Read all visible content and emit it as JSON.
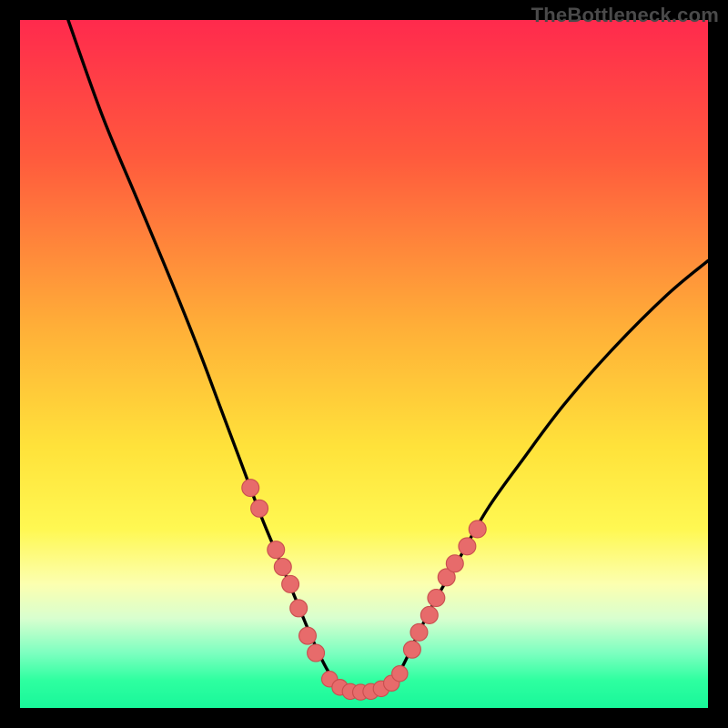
{
  "watermark": "TheBottleneck.com",
  "colors": {
    "frame": "#000000",
    "curve": "#000000",
    "marker_fill": "#e76b6b",
    "marker_stroke": "#c94f4f",
    "gradient_stops": [
      {
        "offset": 0.0,
        "color": "#ff2a4d"
      },
      {
        "offset": 0.2,
        "color": "#ff5a3d"
      },
      {
        "offset": 0.45,
        "color": "#ffb038"
      },
      {
        "offset": 0.62,
        "color": "#ffe23a"
      },
      {
        "offset": 0.74,
        "color": "#fff852"
      },
      {
        "offset": 0.82,
        "color": "#fcffb0"
      },
      {
        "offset": 0.87,
        "color": "#d8ffcf"
      },
      {
        "offset": 0.92,
        "color": "#7dffc0"
      },
      {
        "offset": 0.96,
        "color": "#2effa0"
      },
      {
        "offset": 1.0,
        "color": "#18f79a"
      }
    ]
  },
  "chart_data": {
    "type": "line",
    "title": "",
    "xlabel": "",
    "ylabel": "",
    "xlim": [
      0,
      100
    ],
    "ylim": [
      0,
      100
    ],
    "series": [
      {
        "name": "bottleneck-curve",
        "x": [
          7,
          12,
          17,
          22,
          26,
          29,
          32,
          35,
          37.5,
          40,
          42.5,
          45,
          47.5,
          50,
          52.5,
          55,
          57.5,
          60,
          64,
          68,
          73,
          79,
          86,
          94,
          100
        ],
        "y": [
          100,
          86,
          74,
          62,
          52,
          44,
          36,
          28,
          22,
          16,
          10,
          5,
          2.5,
          2,
          2.5,
          5,
          10,
          15,
          22,
          29,
          36,
          44,
          52,
          60,
          65
        ]
      }
    ],
    "markers_left": {
      "name": "left-cluster",
      "x": [
        33.5,
        34.8,
        37.2,
        38.2,
        39.3,
        40.5,
        41.8,
        43.0
      ],
      "y": [
        32.0,
        29.0,
        23.0,
        20.5,
        18.0,
        14.5,
        10.5,
        8.0
      ]
    },
    "markers_right": {
      "name": "right-cluster",
      "x": [
        57.0,
        58.0,
        59.5,
        60.5,
        62.0,
        63.2,
        65.0,
        66.5
      ],
      "y": [
        8.5,
        11.0,
        13.5,
        16.0,
        19.0,
        21.0,
        23.5,
        26.0
      ]
    },
    "markers_bottom": {
      "name": "valley-cluster",
      "x": [
        45.0,
        46.5,
        48.0,
        49.5,
        51.0,
        52.5,
        54.0,
        55.2
      ],
      "y": [
        4.2,
        3.0,
        2.4,
        2.3,
        2.4,
        2.8,
        3.6,
        5.0
      ]
    }
  }
}
